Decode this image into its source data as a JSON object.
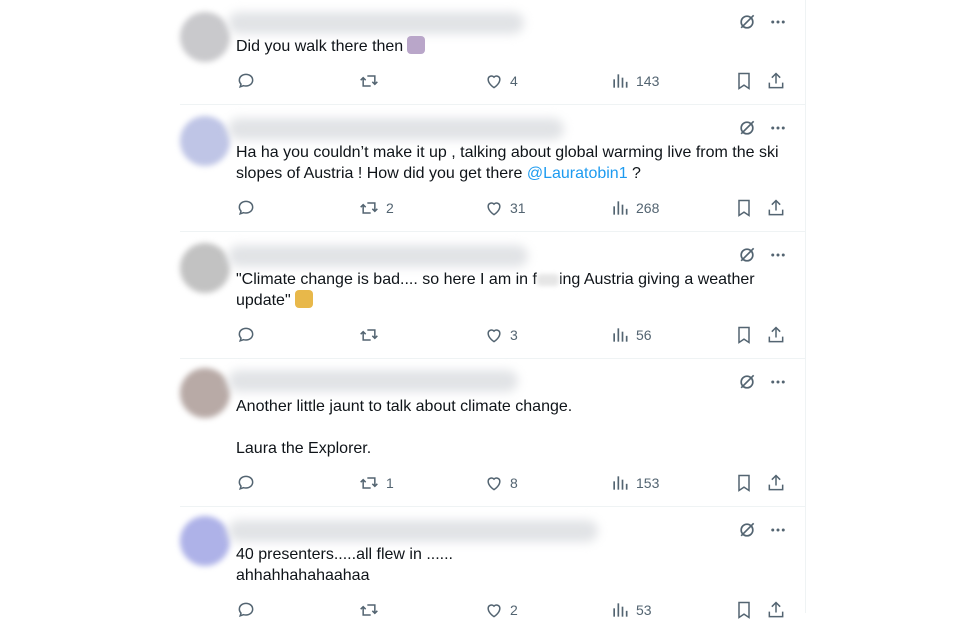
{
  "tweets": [
    {
      "text": "Did you walk there then",
      "emoji": "face-palm-emoji",
      "replies": "",
      "retweets": "",
      "likes": "4",
      "views": "143"
    },
    {
      "text_before": "Ha ha you couldn’t make it up , talking about global warming live from the ski slopes of Austria ! How did you get there ",
      "mention": "@Lauratobin1",
      "text_after": " ?",
      "replies": "",
      "retweets": "2",
      "likes": "31",
      "views": "268"
    },
    {
      "text_before": "\"Climate change is bad.... so here I am in f",
      "text_after": "ing Austria giving a weather update\"",
      "emoji": "shrug-emoji",
      "replies": "",
      "retweets": "",
      "likes": "3",
      "views": "56"
    },
    {
      "text_line1": "Another little jaunt to talk about climate change.",
      "text_line2": "Laura the Explorer.",
      "replies": "",
      "retweets": "1",
      "likes": "8",
      "views": "153"
    },
    {
      "text_line1": "40 presenters.....all flew in ......",
      "text_line2": "ahhahhahahaahaa",
      "replies": "",
      "retweets": "",
      "likes": "2",
      "views": "53"
    }
  ],
  "colors": {
    "icon": "#536471",
    "text": "#0f1419",
    "mention": "#1d9bf0",
    "divider": "#eff3f4"
  },
  "icons": [
    "grok-icon",
    "more-icon",
    "reply-icon",
    "retweet-icon",
    "like-icon",
    "views-icon",
    "bookmark-icon",
    "share-icon"
  ]
}
